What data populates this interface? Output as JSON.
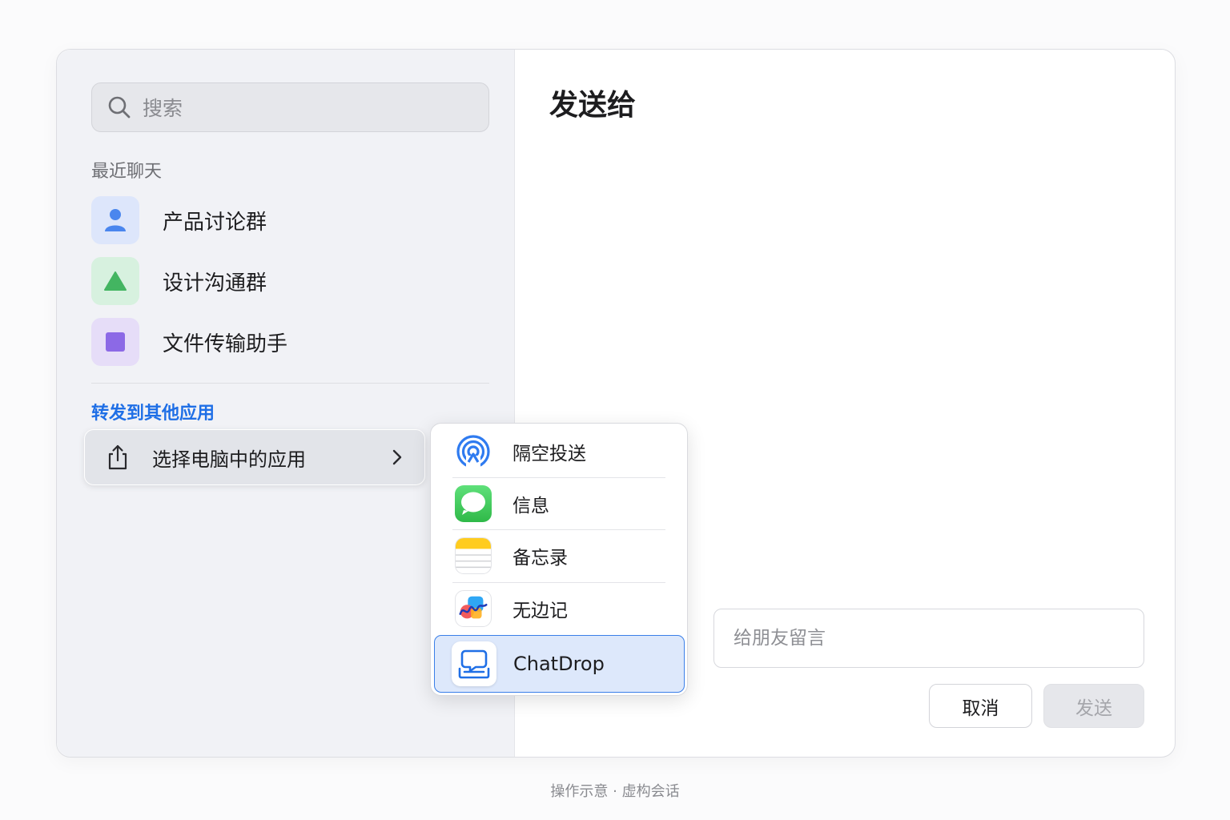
{
  "sidebar": {
    "search_placeholder": "搜索",
    "recent_label": "最近聊天",
    "chats": [
      {
        "name": "产品讨论群",
        "icon": "person-icon",
        "bg": "#dde6fb",
        "fg": "#4a86ee"
      },
      {
        "name": "设计沟通群",
        "icon": "triangle-icon",
        "bg": "#d7f1df",
        "fg": "#43b561"
      },
      {
        "name": "文件传输助手",
        "icon": "square-icon",
        "bg": "#e6ddf8",
        "fg": "#8c69e6"
      }
    ],
    "forward_label": "转发到其他应用",
    "choose_app_label": "选择电脑中的应用"
  },
  "main": {
    "title": "发送给",
    "message_placeholder": "给朋友留言",
    "cancel_label": "取消",
    "send_label": "发送"
  },
  "app_menu": {
    "items": [
      {
        "name": "隔空投送",
        "icon": "airdrop-icon"
      },
      {
        "name": "信息",
        "icon": "messages-icon"
      },
      {
        "name": "备忘录",
        "icon": "notes-icon"
      },
      {
        "name": "无边记",
        "icon": "freeform-icon"
      },
      {
        "name": "ChatDrop",
        "icon": "chatdrop-icon",
        "selected": true
      }
    ]
  },
  "footer": {
    "text": "操作示意 · 虚构会话"
  },
  "colors": {
    "accent": "#1f6fe6",
    "selection": "#dde8fb",
    "selection_border": "#3a7fe8"
  }
}
